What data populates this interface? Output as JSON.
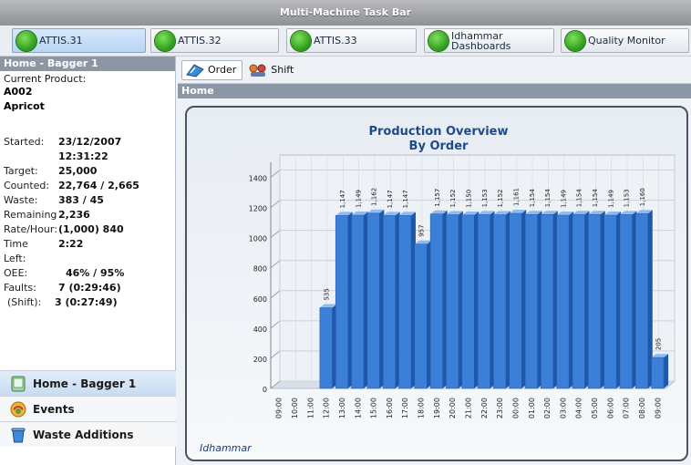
{
  "window": {
    "title": "Multi-Machine Task Bar"
  },
  "taskbar": {
    "items": [
      {
        "label": "ATTIS.31",
        "active": true
      },
      {
        "label": "ATTIS.32",
        "active": false
      },
      {
        "label": "ATTIS.33",
        "active": false
      },
      {
        "label": "Idhammar Dashboards",
        "active": false
      },
      {
        "label": "Quality Monitor",
        "active": false
      }
    ]
  },
  "machine": {
    "header": "Home - Bagger 1",
    "product_label": "Current Product:",
    "product_code": "A002",
    "product_name": "Apricot",
    "stats": [
      {
        "key": "Started:",
        "value": "23/12/2007"
      },
      {
        "key": "",
        "value": "12:31:22"
      },
      {
        "key": "Target:",
        "value": "25,000"
      },
      {
        "key": "Counted:",
        "value": "22,764 / 2,665"
      },
      {
        "key": "Waste:",
        "value": "383 / 45"
      },
      {
        "key": "Remaining",
        "value": "2,236"
      },
      {
        "key": "Rate/Hour:",
        "value": "(1,000) 840"
      },
      {
        "key": "Time Left:",
        "value": "2:22"
      },
      {
        "key": "OEE:",
        "value": "46% / 95%"
      },
      {
        "key": "Faults:",
        "value": "7 (0:29:46)"
      },
      {
        "key": "(Shift):",
        "value": "3 (0:27:49)"
      }
    ]
  },
  "nav": {
    "items": [
      {
        "label": "Home - Bagger 1",
        "icon": "bagger-icon",
        "selected": true
      },
      {
        "label": "Events",
        "icon": "events-icon",
        "selected": false
      },
      {
        "label": "Waste Additions",
        "icon": "waste-bin-icon",
        "selected": false
      }
    ]
  },
  "tabs": {
    "order": "Order",
    "shift": "Shift"
  },
  "breadcrumb": "Home",
  "brand": "Idhammar",
  "colors": {
    "bar": "#3b7fd6",
    "bar_dark": "#1f58a8",
    "title": "#1e4a8c",
    "header": "#8d96a4"
  },
  "chart_data": {
    "type": "bar",
    "title": "Production Overview",
    "subtitle": "By Order",
    "categories": [
      "09:00",
      "10:00",
      "11:00",
      "12:00",
      "13:00",
      "14:00",
      "15:00",
      "16:00",
      "17:00",
      "18:00",
      "19:00",
      "20:00",
      "21:00",
      "22:00",
      "23:00",
      "00:00",
      "01:00",
      "02:00",
      "03:00",
      "04:00",
      "05:00",
      "06:00",
      "07:00",
      "08:00",
      "09:00"
    ],
    "values": [
      0,
      0,
      0,
      535,
      1147,
      1149,
      1162,
      1147,
      1147,
      957,
      1157,
      1152,
      1150,
      1153,
      1152,
      1161,
      1154,
      1154,
      1149,
      1154,
      1154,
      1149,
      1153,
      1160,
      205
    ],
    "value_labels": [
      "",
      "",
      "",
      "535",
      "1,147",
      "1,149",
      "1,162",
      "1,147",
      "1,147",
      "957",
      "1,157",
      "1,152",
      "1,150",
      "1,153",
      "1,152",
      "1,161",
      "1,154",
      "1,154",
      "1,149",
      "1,154",
      "1,154",
      "1,149",
      "1,153",
      "1,160",
      "205"
    ],
    "yticks": [
      0,
      200,
      400,
      600,
      800,
      1000,
      1200,
      1400
    ],
    "ylim": [
      0,
      1500
    ],
    "grid": true
  }
}
